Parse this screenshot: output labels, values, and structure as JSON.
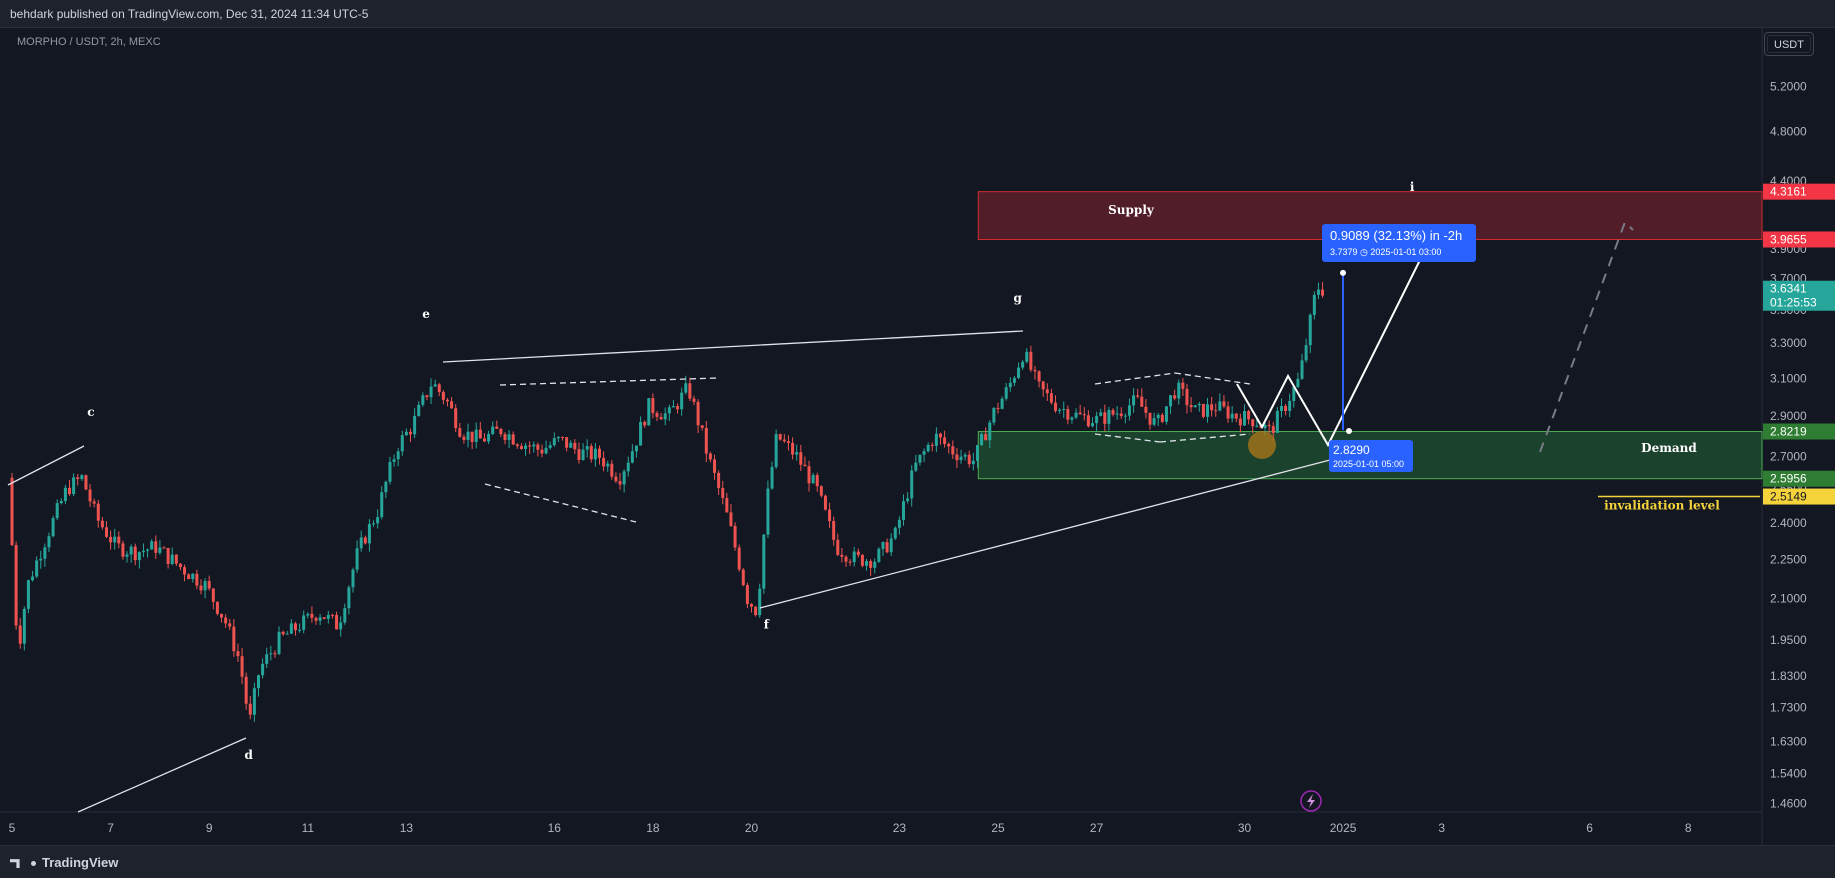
{
  "header": {
    "publisher_line": "behdark published on TradingView.com, Dec 31, 2024 11:34 UTC-5"
  },
  "symbol_info": "MORPHO / USDT, 2h, MEXC",
  "unit_button": "USDT",
  "footer": {
    "brand": "TradingView"
  },
  "colors": {
    "background": "#131722",
    "up": "#26a69a",
    "down": "#ef5350",
    "supply_zone": "#5c1f2a",
    "demand_zone": "#1d4a2e",
    "measure": "#2962ff",
    "invalidation": "#f5d33b",
    "text": "#d1d4dc"
  },
  "chart_data": {
    "type": "candlestick",
    "price_scale": "log",
    "y_tick_labels": [
      "5.2000",
      "4.8000",
      "4.4000",
      "3.9000",
      "3.7000",
      "3.5000",
      "3.3000",
      "3.1000",
      "2.9000",
      "2.7000",
      "2.5500",
      "2.4000",
      "2.2500",
      "2.1000",
      "1.9500",
      "1.8300",
      "1.7300",
      "1.6300",
      "1.5400",
      "1.4600"
    ],
    "x_tick_labels": [
      {
        "label": "5",
        "day": 5
      },
      {
        "label": "7",
        "day": 7
      },
      {
        "label": "9",
        "day": 9
      },
      {
        "label": "11",
        "day": 11
      },
      {
        "label": "13",
        "day": 13
      },
      {
        "label": "16",
        "day": 16
      },
      {
        "label": "18",
        "day": 18
      },
      {
        "label": "20",
        "day": 20
      },
      {
        "label": "23",
        "day": 23
      },
      {
        "label": "25",
        "day": 25
      },
      {
        "label": "27",
        "day": 27
      },
      {
        "label": "30",
        "day": 30
      },
      {
        "label": "2025",
        "day": 32
      },
      {
        "label": "3",
        "day": 34
      },
      {
        "label": "6",
        "day": 37
      },
      {
        "label": "8",
        "day": 39
      }
    ],
    "price_path": [
      [
        5.0,
        2.6
      ],
      [
        5.2,
        1.9
      ],
      [
        5.4,
        2.15
      ],
      [
        5.8,
        2.35
      ],
      [
        6.2,
        2.55
      ],
      [
        6.5,
        2.6
      ],
      [
        6.8,
        2.42
      ],
      [
        7.2,
        2.3
      ],
      [
        7.6,
        2.28
      ],
      [
        8.0,
        2.3
      ],
      [
        8.5,
        2.22
      ],
      [
        9.0,
        2.15
      ],
      [
        9.4,
        2.02
      ],
      [
        9.7,
        1.88
      ],
      [
        9.9,
        1.68
      ],
      [
        10.1,
        1.85
      ],
      [
        10.5,
        1.95
      ],
      [
        10.9,
        2.0
      ],
      [
        11.3,
        2.05
      ],
      [
        11.7,
        2.0
      ],
      [
        12.1,
        2.28
      ],
      [
        12.5,
        2.45
      ],
      [
        12.9,
        2.75
      ],
      [
        13.2,
        2.85
      ],
      [
        13.6,
        3.08
      ],
      [
        13.9,
        2.98
      ],
      [
        14.2,
        2.82
      ],
      [
        14.6,
        2.78
      ],
      [
        15.0,
        2.83
      ],
      [
        15.4,
        2.77
      ],
      [
        15.8,
        2.73
      ],
      [
        16.2,
        2.78
      ],
      [
        16.6,
        2.72
      ],
      [
        17.0,
        2.7
      ],
      [
        17.4,
        2.6
      ],
      [
        17.7,
        2.75
      ],
      [
        18.0,
        2.95
      ],
      [
        18.4,
        2.9
      ],
      [
        18.8,
        3.05
      ],
      [
        19.2,
        2.7
      ],
      [
        19.6,
        2.42
      ],
      [
        20.0,
        2.1
      ],
      [
        20.2,
        2.05
      ],
      [
        20.4,
        2.5
      ],
      [
        20.6,
        2.8
      ],
      [
        21.0,
        2.7
      ],
      [
        21.4,
        2.55
      ],
      [
        21.8,
        2.3
      ],
      [
        22.2,
        2.25
      ],
      [
        22.6,
        2.25
      ],
      [
        23.0,
        2.35
      ],
      [
        23.4,
        2.65
      ],
      [
        23.8,
        2.8
      ],
      [
        24.2,
        2.72
      ],
      [
        24.6,
        2.68
      ],
      [
        25.0,
        2.92
      ],
      [
        25.3,
        3.05
      ],
      [
        25.6,
        3.25
      ],
      [
        25.9,
        3.05
      ],
      [
        26.3,
        2.95
      ],
      [
        26.7,
        2.9
      ],
      [
        27.1,
        2.88
      ],
      [
        27.5,
        2.92
      ],
      [
        27.9,
        2.98
      ],
      [
        28.3,
        2.85
      ],
      [
        28.7,
        3.05
      ],
      [
        29.1,
        2.92
      ],
      [
        29.5,
        2.95
      ],
      [
        29.9,
        2.9
      ],
      [
        30.3,
        2.88
      ],
      [
        30.6,
        2.82
      ],
      [
        30.9,
        2.95
      ],
      [
        31.2,
        3.1
      ],
      [
        31.4,
        3.4
      ],
      [
        31.55,
        3.65
      ],
      [
        31.65,
        3.63
      ]
    ],
    "zones": [
      {
        "label": "Supply",
        "top": 4.3161,
        "bottom": 3.9655
      },
      {
        "label": "Demand",
        "top": 2.8219,
        "bottom": 2.5956
      }
    ],
    "price_labels": [
      {
        "text": "4.3161",
        "price": 4.3161,
        "color": "#f23645"
      },
      {
        "text": "3.9655",
        "price": 3.9655,
        "color": "#f23645"
      },
      {
        "text": "3.6341",
        "price": 3.6341,
        "color": "#26a69a",
        "sub": "01:25:53"
      },
      {
        "text": "2.8219",
        "price": 2.8219,
        "color": "#2e7d32"
      },
      {
        "text": "2.5956",
        "price": 2.5956,
        "color": "#2e7d32"
      },
      {
        "text": "2.5149",
        "price": 2.5149,
        "color": "#f5d33b"
      }
    ],
    "invalidation_label": "invalidation level",
    "invalidation_price": 2.5149,
    "wave_labels": [
      {
        "text": "c",
        "day": 6.6,
        "price": 2.9
      },
      {
        "text": "d",
        "day": 9.8,
        "price": 1.58
      },
      {
        "text": "e",
        "day": 13.4,
        "price": 3.45
      },
      {
        "text": "f",
        "day": 20.3,
        "price": 1.99
      },
      {
        "text": "g",
        "day": 25.4,
        "price": 3.55
      },
      {
        "text": "i",
        "day": 33.4,
        "price": 4.32
      }
    ],
    "measure": {
      "change_text": "0.9089 (32.13%) in -2h",
      "detail_text": "3.7379 ◷ 2025-01-01  03:00",
      "from_price": 2.829,
      "to_price": 3.7379,
      "low_label": "2.8290",
      "low_detail": "2025-01-01 05:00"
    }
  }
}
